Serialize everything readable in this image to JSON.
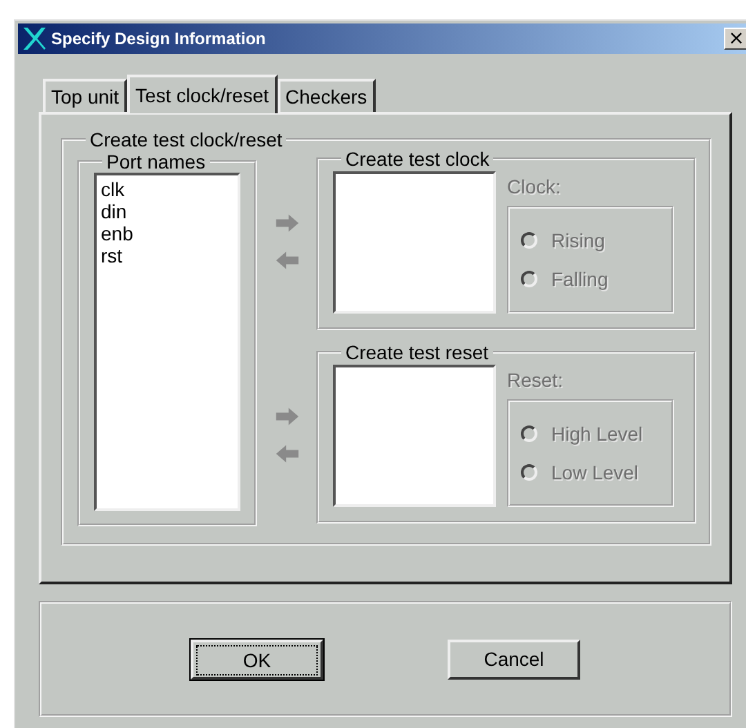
{
  "window": {
    "title": "Specify Design Information",
    "close": "×"
  },
  "tabs": [
    {
      "label": "Top unit",
      "selected": false
    },
    {
      "label": "Test clock/reset",
      "selected": true
    },
    {
      "label": "Checkers",
      "selected": false
    }
  ],
  "group": {
    "title": "Create test clock/reset",
    "port_names": {
      "title": "Port names",
      "items": [
        "clk",
        "din",
        "enb",
        "rst"
      ]
    },
    "sections": [
      {
        "title": "Create test clock",
        "label": "Clock:",
        "disabled": true,
        "arrows_disabled": true,
        "options": [
          {
            "label": "Rising",
            "checked": false
          },
          {
            "label": "Falling",
            "checked": false
          }
        ]
      },
      {
        "title": "Create test reset",
        "label": "Reset:",
        "disabled": true,
        "arrows_disabled": true,
        "options": [
          {
            "label": "High Level",
            "checked": false
          },
          {
            "label": "Low Level",
            "checked": false
          }
        ]
      }
    ]
  },
  "buttons": [
    {
      "label": "OK",
      "default": true
    },
    {
      "label": "Cancel",
      "default": false
    }
  ]
}
